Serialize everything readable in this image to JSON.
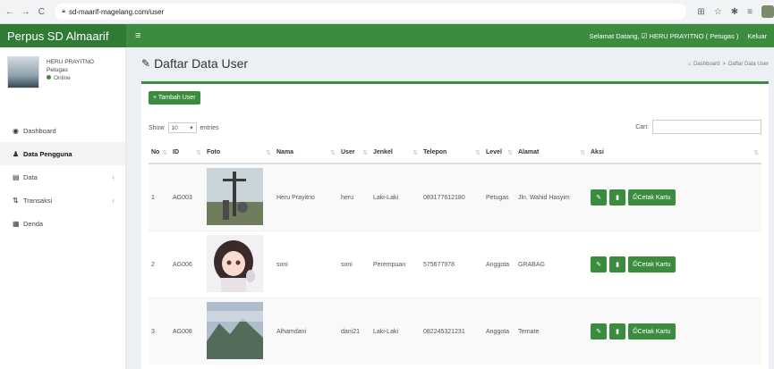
{
  "browser": {
    "back": "←",
    "forward": "→",
    "reload": "C",
    "url": "sd-maarif-magelang.com/user"
  },
  "header": {
    "brand": "Perpus SD Almaarif",
    "menu_icon": "≡",
    "greeting": "Selamat Datang, ☑ HERU PRAYITNO ( Petugas )",
    "logout": "Keluar"
  },
  "sidebar": {
    "user_name": "HERU PRAYITNO",
    "user_role": "Petugas",
    "status": "Online",
    "items": [
      {
        "label": "Dashboard",
        "icon": "dashboard-icon",
        "glyph": "◉"
      },
      {
        "label": "Data Pengguna",
        "icon": "user-icon",
        "glyph": "♟"
      },
      {
        "label": "Data",
        "icon": "data-icon",
        "glyph": "▤",
        "caret": "‹"
      },
      {
        "label": "Transaksi",
        "icon": "transfer-icon",
        "glyph": "⇅",
        "caret": "‹"
      },
      {
        "label": "Denda",
        "icon": "denda-icon",
        "glyph": "▦"
      }
    ]
  },
  "page": {
    "title": "Daftar Data User",
    "breadcrumb_home": "Dashboard",
    "breadcrumb_sep": ">",
    "breadcrumb_current": "Daftar Data User",
    "add_button": "+ Tambah User",
    "show": "Show",
    "entries_value": "10",
    "entries": "entries",
    "search_label": "Cari:"
  },
  "table": {
    "columns": [
      "No",
      "ID",
      "Foto",
      "Nama",
      "User",
      "Jenkel",
      "Telepon",
      "Level",
      "Alamat",
      "Aksi"
    ],
    "rows": [
      {
        "no": "1",
        "id": "AG003",
        "nama": "Heru Prayitno",
        "user": "heru",
        "jenkel": "Laki-Laki",
        "telepon": "083177612180",
        "level": "Petugas",
        "alamat": "Jln. Wahid Hasyim",
        "photo": "cross-landscape"
      },
      {
        "no": "2",
        "id": "AG006",
        "nama": "soni",
        "user": "soni",
        "jenkel": "Perempuan",
        "telepon": "575677978",
        "level": "Anggota",
        "alamat": "GRABAG",
        "photo": "anime-girl"
      },
      {
        "no": "3",
        "id": "AG008",
        "nama": "Alhamdani",
        "user": "dani21",
        "jenkel": "Laki-Laki",
        "telepon": "082245321231",
        "level": "Anggota",
        "alamat": "Ternate",
        "photo": "mountain"
      }
    ],
    "cetak_label": "Cetak Kartu"
  },
  "colors": {
    "primary": "#3c8c40",
    "brand_dark": "#2f7a34",
    "content_bg": "#ecf0f5"
  }
}
